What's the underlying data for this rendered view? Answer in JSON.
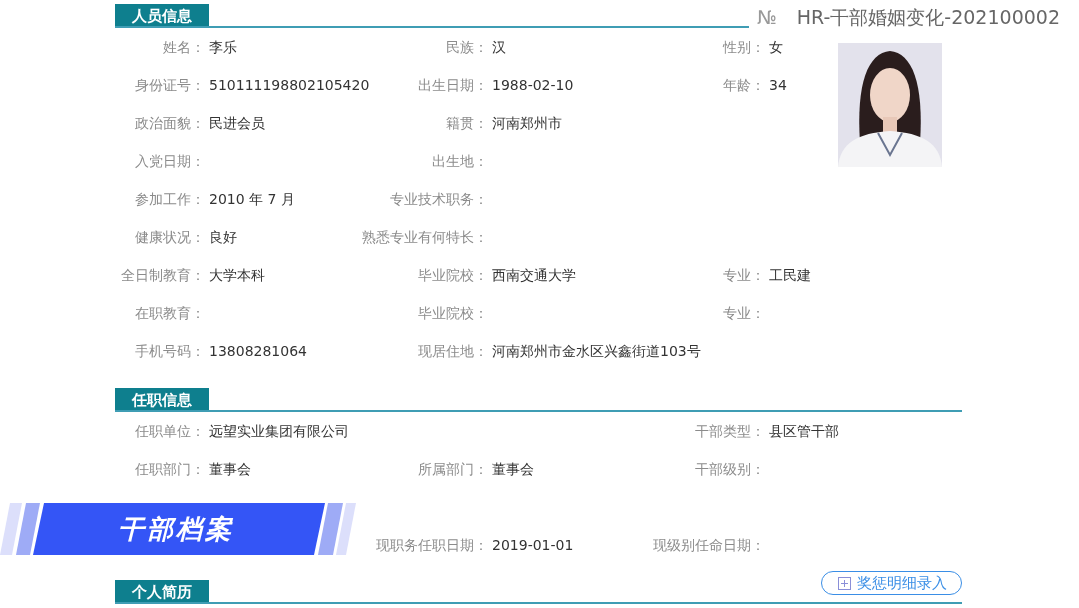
{
  "document_number": {
    "symbol": "№",
    "value": "HR-干部婚姻变化-202100002"
  },
  "banner": {
    "title": "干部档案"
  },
  "sections": [
    {
      "title": "人员信息",
      "rows": [
        {
          "left": {
            "label": "姓名：",
            "value": "李乐"
          },
          "middle": {
            "label": "民族：",
            "value": "汉"
          },
          "right": {
            "label": "性别：",
            "value": "女"
          }
        },
        {
          "left": {
            "label": "身份证号：",
            "value": "510111198802105420"
          },
          "middle": {
            "label": "出生日期：",
            "value": "1988-02-10"
          },
          "right": {
            "label": "年龄：",
            "value": "34"
          }
        },
        {
          "left": {
            "label": "政治面貌：",
            "value": "民进会员"
          },
          "middle": {
            "label": "籍贯：",
            "value": "河南郑州市"
          }
        },
        {
          "left": {
            "label": "入党日期："
          },
          "middle": {
            "label": "出生地："
          }
        },
        {
          "left": {
            "label": "参加工作：",
            "value": "2010 年 7 月"
          },
          "middle": {
            "label": "专业技术职务："
          }
        },
        {
          "left": {
            "label": "健康状况：",
            "value": "良好"
          },
          "middle": {
            "label": "熟悉专业有何特长："
          }
        },
        {
          "left": {
            "label": "全日制教育：",
            "value": "大学本科"
          },
          "middle": {
            "label": "毕业院校：",
            "value": "西南交通大学"
          },
          "right": {
            "label": "专业：",
            "value": "工民建"
          }
        },
        {
          "left": {
            "label": "在职教育："
          },
          "middle": {
            "label": "毕业院校："
          },
          "right": {
            "label": "专业："
          }
        },
        {
          "left": {
            "label": "手机号码：",
            "value": "13808281064"
          },
          "middle": {
            "label": "现居住地：",
            "value": "河南郑州市金水区兴鑫街道103号"
          }
        }
      ]
    },
    {
      "title": "任职信息",
      "rows": [
        {
          "left": {
            "label": "任职单位：",
            "value": "远望实业集团有限公司"
          },
          "right": {
            "label": "干部类型：",
            "value": "县区管干部"
          }
        },
        {
          "left": {
            "label": "任职部门：",
            "value": "董事会"
          },
          "middle": {
            "label": "所属部门：",
            "value": "董事会"
          },
          "right": {
            "label": "干部级别："
          }
        },
        {},
        {
          "middle": {
            "label": "现职务任职日期：",
            "value": "2019-01-01"
          },
          "right": {
            "label": "现级别任命日期："
          }
        }
      ]
    },
    {
      "title": "个人简历",
      "button": "奖惩明细录入"
    }
  ]
}
